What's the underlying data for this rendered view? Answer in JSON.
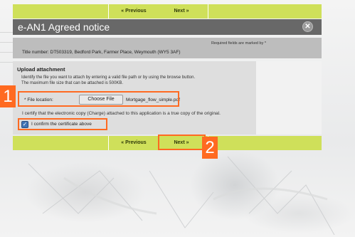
{
  "nav": {
    "previous_label": "« Previous",
    "next_label": "Next »"
  },
  "window": {
    "title": "e-AN1 Agreed notice",
    "close_icon": "close-icon"
  },
  "info": {
    "required_note": "Required fields are marked by *",
    "title_number": "Title number: DT503319, Bedford Park, Farmer Place, Weymouth (WY5 3AF)"
  },
  "upload": {
    "heading": "Upload attachment",
    "desc_line1": "Identify the file you want to attach by entering a valid file path or by using the browse button.",
    "desc_line2": "The maximum file size that can be attached is 500KB.",
    "file_label": "* File location:",
    "choose_button": "Choose File",
    "file_name": "Mortgage_flow_simple.pdf",
    "certify_text": "I certify that the electronic copy (Charge) attached to this application is a true copy of the original.",
    "confirm_label": "I confirm the certificate above",
    "confirm_checked": true
  },
  "annotations": {
    "badge1": "1",
    "badge2": "2",
    "color": "#ff6a21"
  }
}
